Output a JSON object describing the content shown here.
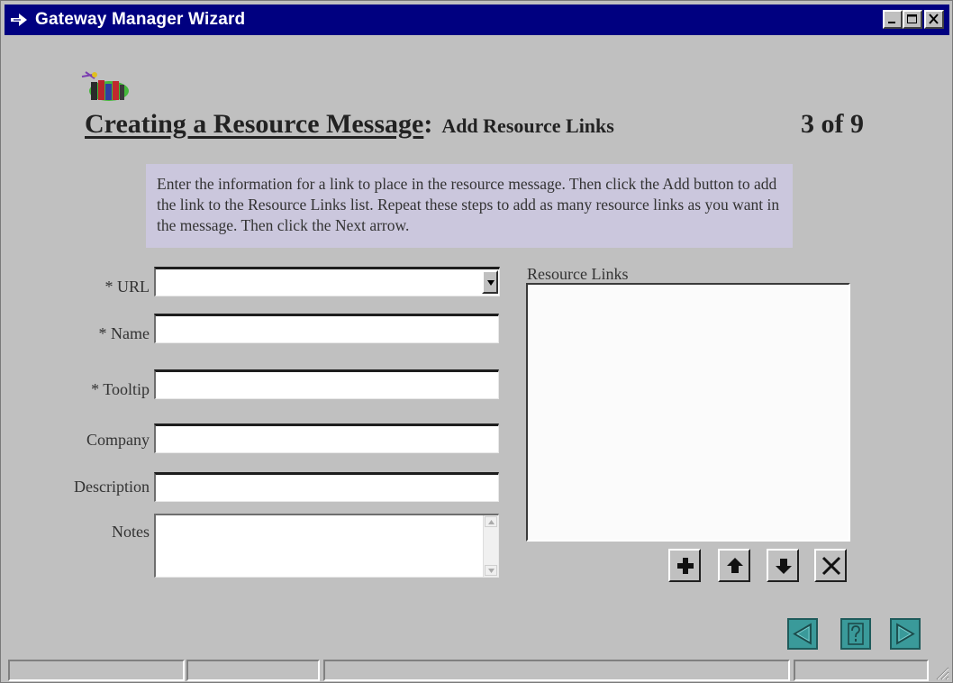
{
  "window": {
    "title": "Gateway Manager Wizard",
    "buttons": [
      "minimize-icon",
      "maximize-icon",
      "close-icon"
    ]
  },
  "header": {
    "title": "Creating a Resource Message",
    "separator": ":",
    "subtitle": "Add Resource Links",
    "step": "3 of 9"
  },
  "instructions": "Enter the information for a link to place in the resource message. Then click the Add button to add the link to the Resource Links list. Repeat these steps to add as many resource links as you want in the message. Then click the Next arrow.",
  "form": {
    "url_label": "* URL",
    "url_value": "",
    "name_label": "* Name",
    "name_value": "",
    "tooltip_label": "* Tooltip",
    "tooltip_value": "",
    "company_label": "Company",
    "company_value": "",
    "description_label": "Description",
    "description_value": "",
    "notes_label": "Notes",
    "notes_value": ""
  },
  "resource_links": {
    "label": "Resource Links",
    "items": [],
    "buttons": [
      "plus-icon",
      "arrow-up-icon",
      "arrow-down-icon",
      "x-delete-icon"
    ]
  },
  "nav": {
    "buttons": [
      "back-arrow-icon",
      "help-question-icon",
      "next-arrow-icon"
    ]
  },
  "statusbar": {
    "segments": [
      "",
      "",
      "",
      ""
    ]
  },
  "colors": {
    "titlebar": "#000080",
    "window_bg": "#c0c0c0",
    "info_box": "#cbc7dd",
    "nav_button": "#3a9a9a"
  }
}
